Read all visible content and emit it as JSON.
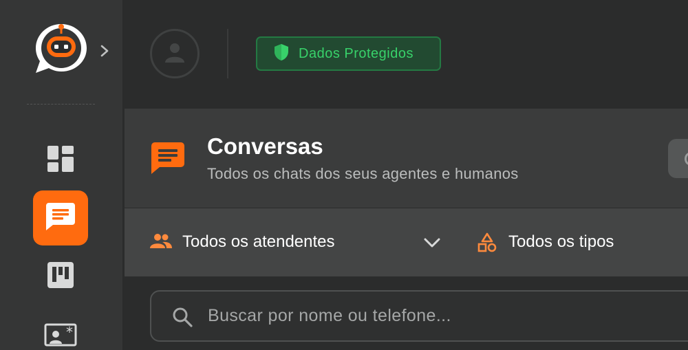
{
  "sidebar": {
    "items": [
      {
        "icon": "dashboard-icon",
        "active": false
      },
      {
        "icon": "chat-icon",
        "active": true
      },
      {
        "icon": "kanban-icon",
        "active": false
      },
      {
        "icon": "contact-card-icon",
        "active": false
      }
    ]
  },
  "topbar": {
    "protect_badge": "Dados Protegidos"
  },
  "header": {
    "title": "Conversas",
    "subtitle": "Todos os chats dos seus agentes e humanos"
  },
  "filters": {
    "attendants": "Todos os atendentes",
    "types": "Todos os tipos"
  },
  "search": {
    "placeholder": "Buscar por nome ou telefone..."
  },
  "colors": {
    "accent": "#ff6b0f",
    "success": "#38d26a",
    "sidebar_bg": "#353636",
    "page_bg": "#2b2c2c"
  }
}
